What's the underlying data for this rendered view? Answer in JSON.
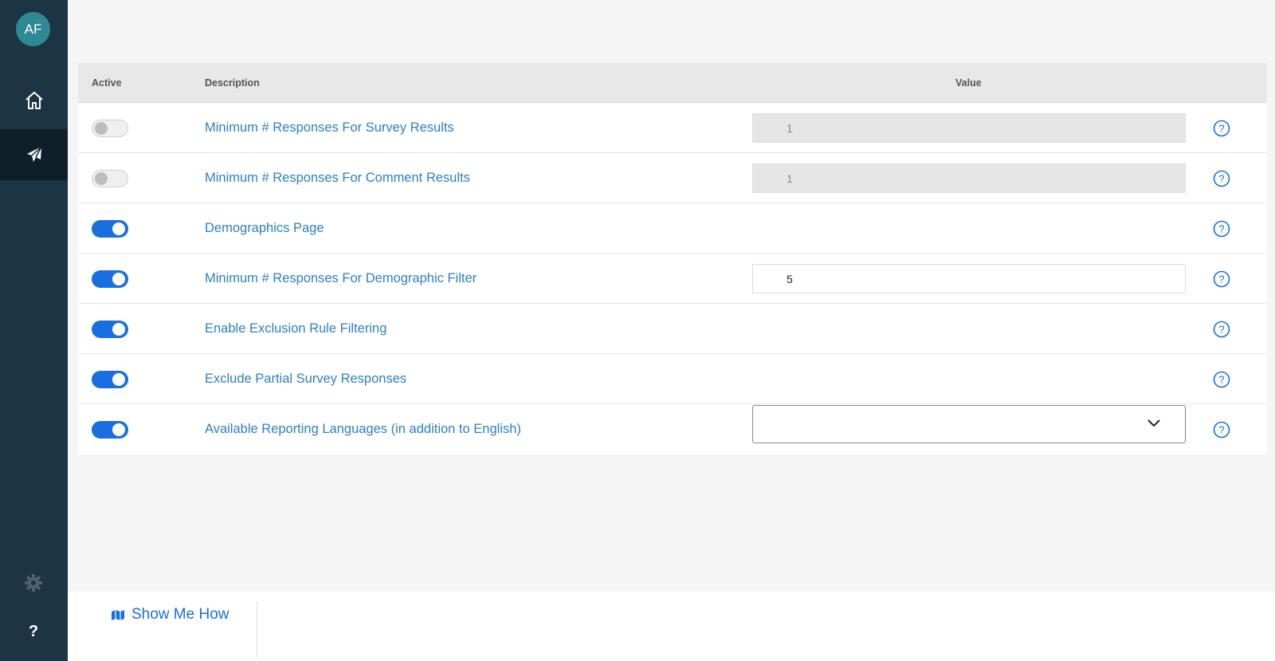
{
  "sidebar": {
    "avatar_initials": "AF",
    "items": [
      {
        "name": "home",
        "icon": "home-icon"
      },
      {
        "name": "surveys",
        "icon": "paper-plane-icon",
        "active": true
      },
      {
        "name": "settings",
        "icon": "gear-icon"
      },
      {
        "name": "help",
        "icon": "help-icon",
        "label": "?"
      }
    ]
  },
  "table": {
    "headers": {
      "active": "Active",
      "description": "Description",
      "value": "Value"
    },
    "rows": [
      {
        "active": false,
        "description": "Minimum # Responses For Survey Results",
        "value": "1",
        "value_type": "input-disabled"
      },
      {
        "active": false,
        "description": "Minimum # Responses For Comment Results",
        "value": "1",
        "value_type": "input-disabled"
      },
      {
        "active": true,
        "description": "Demographics Page",
        "value": "",
        "value_type": "none"
      },
      {
        "active": true,
        "description": "Minimum # Responses For Demographic Filter",
        "value": "5",
        "value_type": "input"
      },
      {
        "active": true,
        "description": "Enable Exclusion Rule Filtering",
        "value": "",
        "value_type": "none"
      },
      {
        "active": true,
        "description": "Exclude Partial Survey Responses",
        "value": "",
        "value_type": "none"
      },
      {
        "active": true,
        "description": "Available Reporting Languages (in addition to English)",
        "value": "",
        "value_type": "select"
      }
    ]
  },
  "footer": {
    "show_me_how": "Show Me How"
  },
  "colors": {
    "accent": "#1a6fe0",
    "link": "#2e7fc3",
    "sidebar": "#1d3444",
    "avatar": "#2d8a92"
  }
}
